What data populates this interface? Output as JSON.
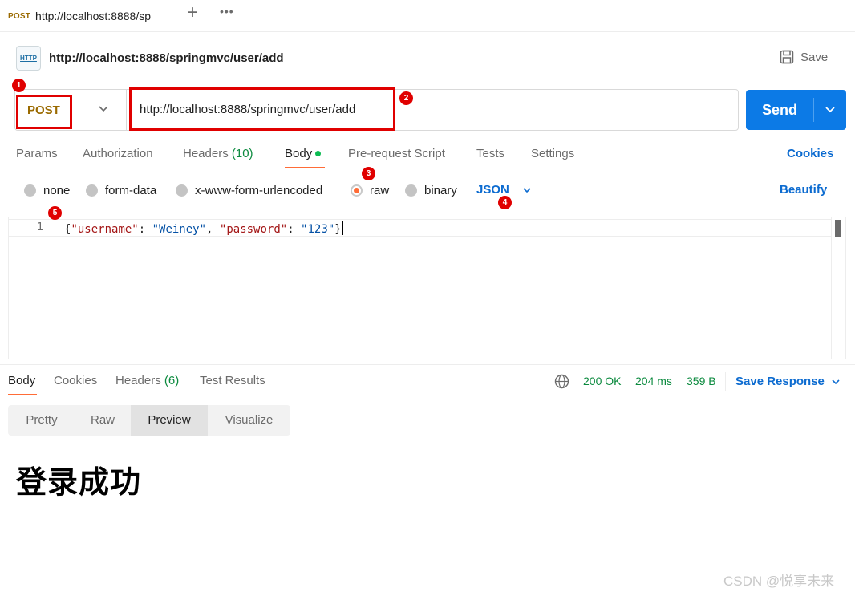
{
  "tab": {
    "method": "POST",
    "url": "http://localhost:8888/sp"
  },
  "request": {
    "icon_label": "HTTP",
    "title": "http://localhost:8888/springmvc/user/add",
    "save_label": "Save",
    "method": "POST",
    "url": "http://localhost:8888/springmvc/user/add",
    "send_label": "Send"
  },
  "request_tabs": {
    "params": "Params",
    "authorization": "Authorization",
    "headers": "Headers",
    "headers_count": "(10)",
    "body": "Body",
    "prerequest": "Pre-request Script",
    "tests": "Tests",
    "settings": "Settings",
    "cookies": "Cookies"
  },
  "body_types": {
    "none": "none",
    "form_data": "form-data",
    "urlencoded": "x-www-form-urlencoded",
    "raw": "raw",
    "binary": "binary",
    "language": "JSON",
    "beautify": "Beautify",
    "selected": "raw"
  },
  "editor": {
    "line_number": "1",
    "tokens": {
      "open": "{",
      "k1": "\"username\"",
      "colon1": ": ",
      "v1": "\"Weiney\"",
      "comma": ", ",
      "k2": "\"password\"",
      "colon2": ": ",
      "v2": "\"123\"",
      "close": "}"
    }
  },
  "annotations": [
    "1",
    "2",
    "3",
    "4",
    "5"
  ],
  "response_tabs": {
    "body": "Body",
    "cookies": "Cookies",
    "headers": "Headers",
    "headers_count": "(6)",
    "test_results": "Test Results"
  },
  "response_status": {
    "status": "200 OK",
    "time": "204 ms",
    "size": "359 B",
    "save_response": "Save Response"
  },
  "view_modes": {
    "pretty": "Pretty",
    "raw": "Raw",
    "preview": "Preview",
    "visualize": "Visualize",
    "selected": "Preview"
  },
  "preview": {
    "text": "登录成功"
  },
  "watermark": "CSDN @悦享未来",
  "colors": {
    "accent": "#ff6c37",
    "send": "#0c7ae6",
    "link": "#0c6bd0",
    "post": "#9a6a00",
    "ok": "#0b8a3e",
    "annotation": "#e00000"
  }
}
